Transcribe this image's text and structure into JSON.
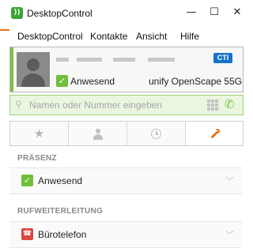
{
  "window": {
    "title": "DesktopControl",
    "app_icon": "app-logo-icon",
    "controls": {
      "minimize": "—",
      "maximize": "☐",
      "close": "✕"
    }
  },
  "menu": [
    "DesktopControl",
    "Kontakte",
    "Ansicht",
    "Hilfe"
  ],
  "contact_card": {
    "badge": "CTI",
    "status": "Anwesend",
    "device": "unify OpenScape 55G"
  },
  "search": {
    "placeholder": "Namen oder Nummer eingeben"
  },
  "tabs": [
    {
      "icon": "star-icon",
      "glyph": "★"
    },
    {
      "icon": "person-icon",
      "glyph": "👤"
    },
    {
      "icon": "clock-icon",
      "glyph": "🕓"
    },
    {
      "icon": "wrench-icon",
      "glyph": "🔧"
    }
  ],
  "sections": {
    "presence": {
      "title": "PRÄSENZ",
      "value": "Anwesend"
    },
    "forwarding": {
      "title": "RUFWEITERLEITUNG",
      "value": "Bürotelefon"
    }
  },
  "colors": {
    "accent_green": "#7cc243",
    "check_green": "#6fbf3a",
    "cti_blue": "#1473c8",
    "wrench_orange": "#e8731a",
    "phone_red": "#d9473f"
  }
}
